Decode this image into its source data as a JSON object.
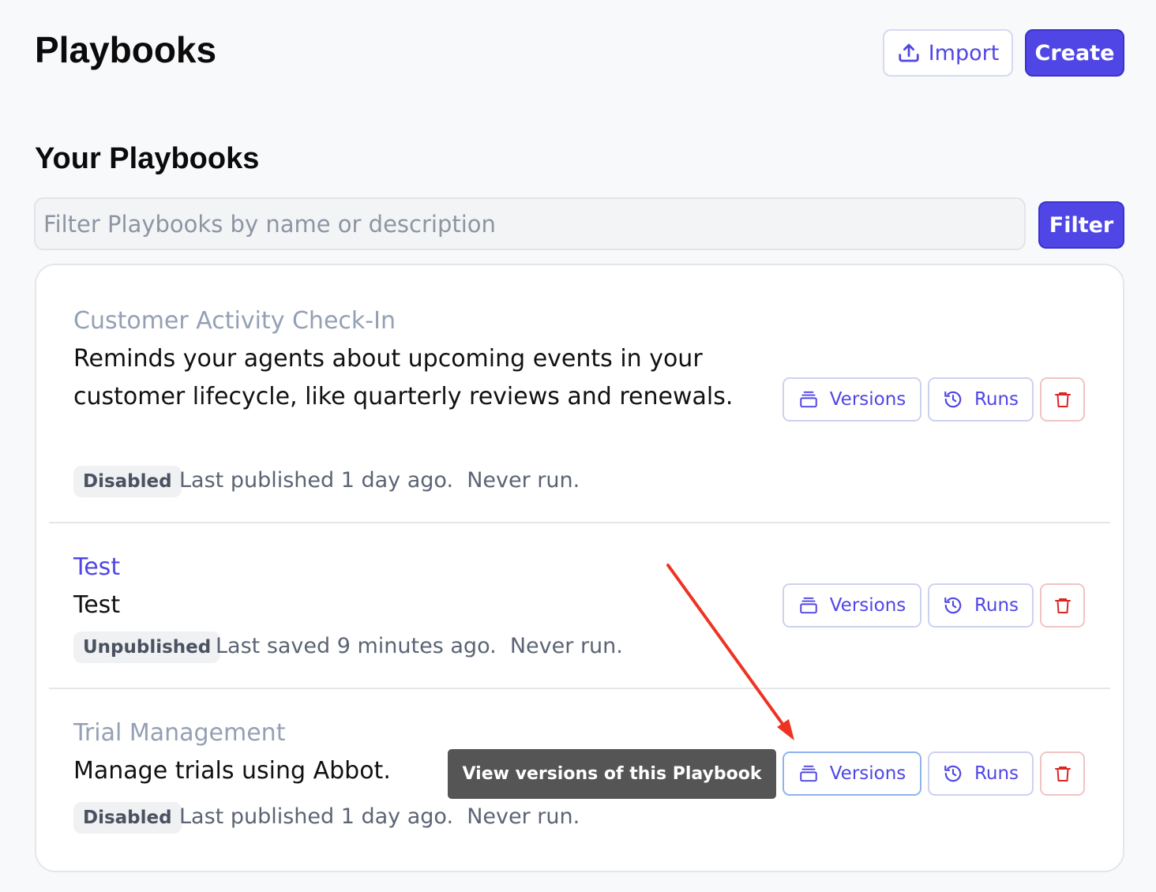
{
  "header": {
    "title": "Playbooks",
    "import_label": "Import",
    "create_label": "Create"
  },
  "section": {
    "title": "Your Playbooks",
    "filter_placeholder": "Filter Playbooks by name or description",
    "filter_value": "",
    "filter_label": "Filter"
  },
  "playbooks": [
    {
      "title": "Customer Activity Check-In",
      "description": "Reminds your agents about upcoming events in your customer lifecycle, like quarterly reviews and renewals.",
      "status": "Disabled",
      "meta": "Last published 1 day ago.  Never run."
    },
    {
      "title": "Test",
      "description": "Test",
      "status": "Unpublished",
      "meta": "Last saved 9 minutes ago.  Never run."
    },
    {
      "title": "Trial Management",
      "description": "Manage trials using Abbot.",
      "status": "Disabled",
      "meta": "Last published 1 day ago.  Never run."
    }
  ],
  "actions": {
    "versions_label": "Versions",
    "runs_label": "Runs"
  },
  "tooltip": {
    "text": "View versions of this Playbook"
  },
  "icons": {
    "import": "upload-icon",
    "versions": "stack-icon",
    "runs": "history-icon",
    "delete": "trash-icon"
  },
  "colors": {
    "accent": "#4f46e5",
    "muted_title": "#94a0b4",
    "danger": "#dc2626",
    "annotation_arrow": "#ee3322"
  }
}
